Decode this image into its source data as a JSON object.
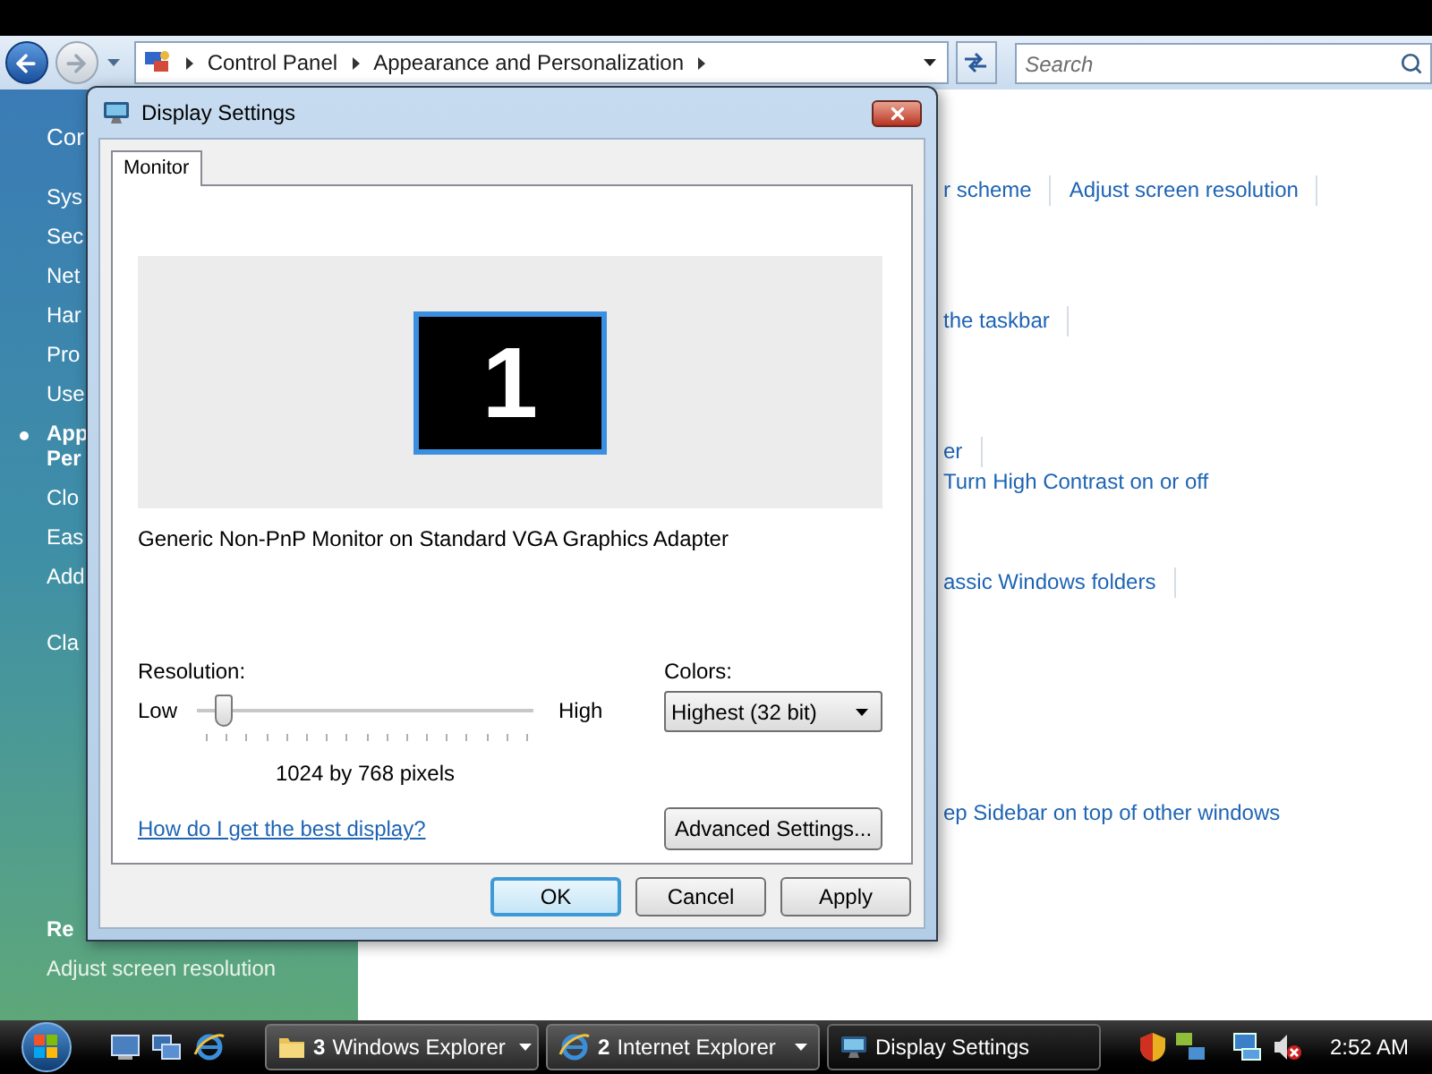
{
  "address_bar": {
    "segments": [
      "Control Panel",
      "Appearance and Personalization"
    ],
    "search": {
      "placeholder": "Search"
    }
  },
  "sidebar": {
    "heading": "Cor",
    "items": [
      {
        "lines": [
          "Sys"
        ],
        "selected": false
      },
      {
        "lines": [
          "Sec"
        ],
        "selected": false
      },
      {
        "lines": [
          "Net"
        ],
        "selected": false
      },
      {
        "lines": [
          "Har"
        ],
        "selected": false
      },
      {
        "lines": [
          "Pro"
        ],
        "selected": false
      },
      {
        "lines": [
          "Use"
        ],
        "selected": false
      },
      {
        "lines": [
          "App",
          "Per"
        ],
        "selected": true
      },
      {
        "lines": [
          "Clo"
        ],
        "selected": false
      },
      {
        "lines": [
          "Eas"
        ],
        "selected": false
      },
      {
        "lines": [
          "Add"
        ],
        "selected": false
      }
    ],
    "extra": "Cla",
    "see_also": {
      "heading": "Re",
      "links": [
        "Adjust screen resolution"
      ]
    }
  },
  "content": {
    "rows": [
      {
        "links": [
          {
            "text": "r scheme",
            "separator": true
          },
          {
            "text": "Adjust screen resolution",
            "separator": true
          }
        ]
      },
      {
        "links": [
          {
            "text": "the taskbar",
            "separator": true
          }
        ]
      },
      {
        "links": [
          {
            "text": "er",
            "separator": true
          }
        ]
      },
      {
        "links": [
          {
            "text": "Turn High Contrast on or off",
            "separator": false
          }
        ]
      },
      {
        "links": [
          {
            "text": "assic Windows folders",
            "separator": true
          }
        ]
      },
      {
        "links": [
          {
            "text": "ep Sidebar on top of other windows",
            "separator": false
          }
        ]
      }
    ]
  },
  "dialog": {
    "title": "Display Settings",
    "tabs": [
      {
        "label": "Monitor",
        "selected": true
      }
    ],
    "monitor_number": "1",
    "adapter": "Generic Non-PnP Monitor on Standard VGA Graphics Adapter",
    "resolution": {
      "label": "Resolution:",
      "low": "Low",
      "high": "High",
      "level": 0.08,
      "reading": "1024 by 768 pixels"
    },
    "colors": {
      "label": "Colors:",
      "value": "Highest (32 bit)"
    },
    "help_link": "How do I get the best display?",
    "advanced_button": "Advanced Settings...",
    "buttons": [
      {
        "label": "OK",
        "default": true
      },
      {
        "label": "Cancel",
        "default": false
      },
      {
        "label": "Apply",
        "default": false
      }
    ]
  },
  "taskbar": {
    "tasks": [
      {
        "kind": "folder",
        "count": "3",
        "label": "Windows Explorer",
        "grouped": true,
        "selected": false
      },
      {
        "kind": "browser",
        "count": "2",
        "label": "Internet Explorer",
        "grouped": true,
        "selected": false
      },
      {
        "kind": "display",
        "label": "Display Settings",
        "grouped": false,
        "selected": true
      }
    ],
    "clock": "2:52 AM"
  }
}
